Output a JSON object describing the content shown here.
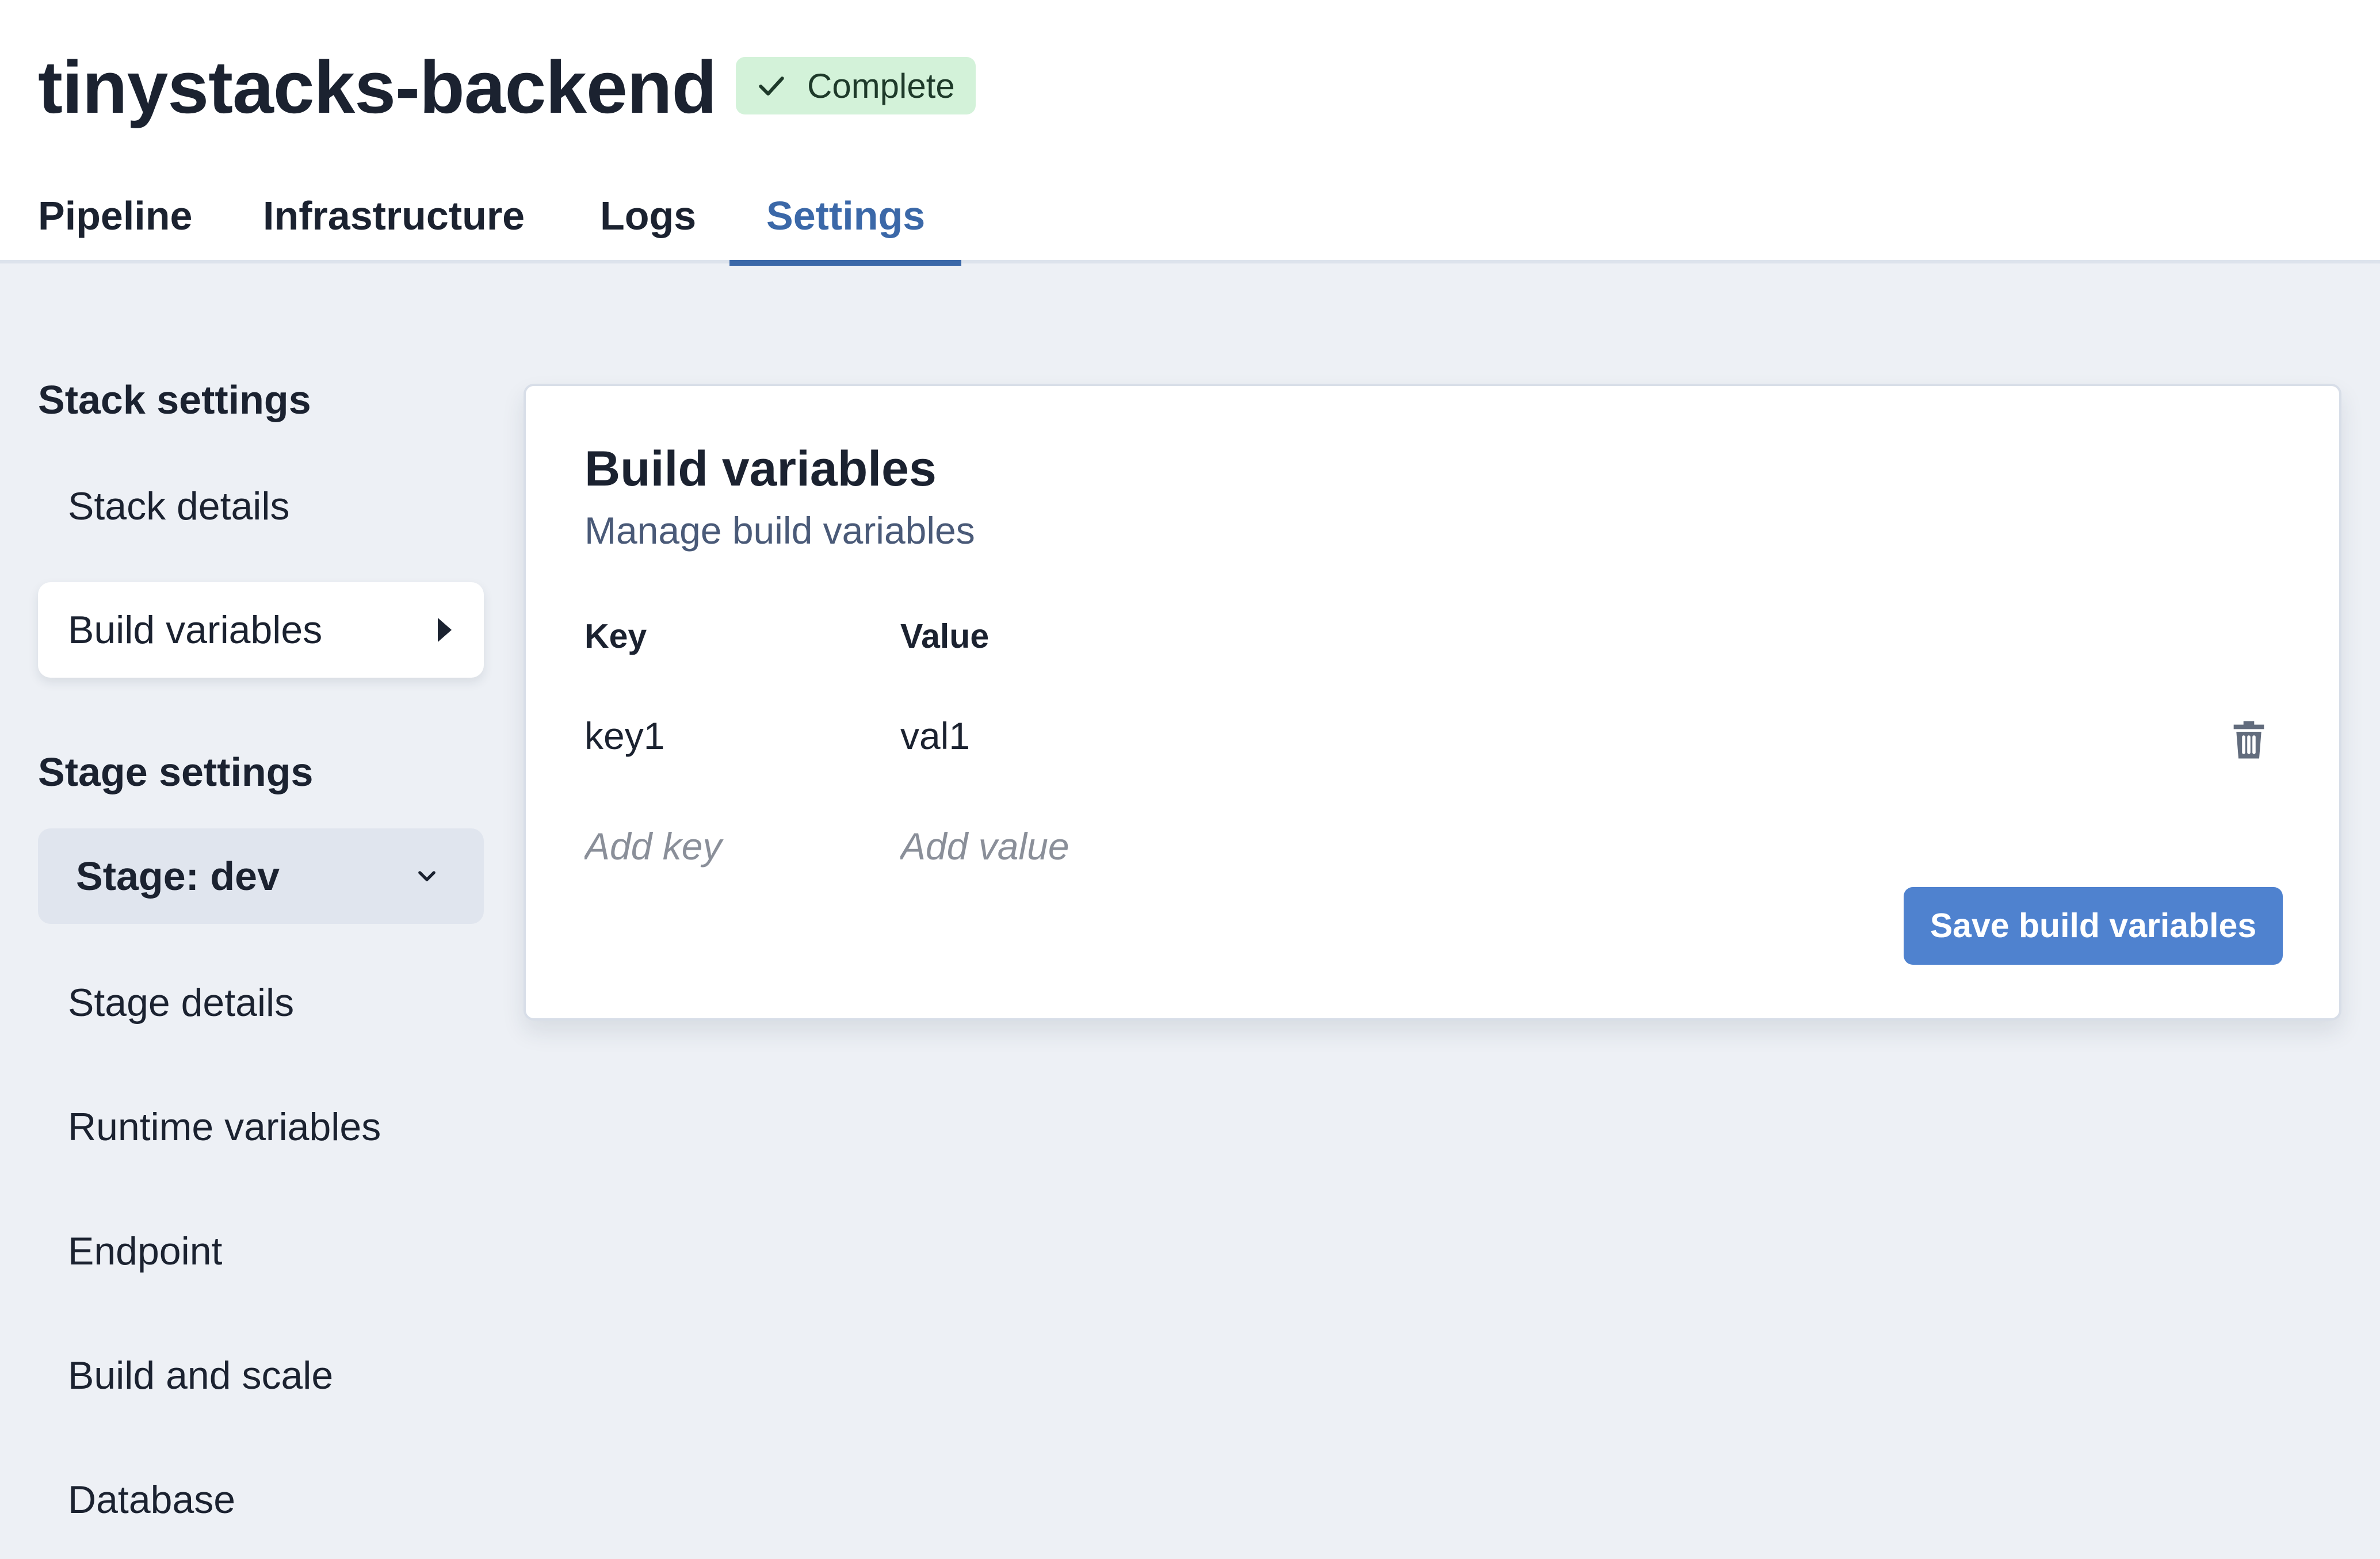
{
  "header": {
    "title": "tinystacks-backend",
    "status": {
      "label": "Complete",
      "icon": "check-icon",
      "color": "#d3f2d9"
    }
  },
  "tabs": [
    {
      "label": "Pipeline",
      "active": false
    },
    {
      "label": "Infrastructure",
      "active": false
    },
    {
      "label": "Logs",
      "active": false
    },
    {
      "label": "Settings",
      "active": true
    }
  ],
  "sidebar": {
    "stack_heading": "Stack settings",
    "stack_items": [
      {
        "label": "Stack details",
        "active": false
      },
      {
        "label": "Build variables",
        "active": true
      }
    ],
    "stage_heading": "Stage settings",
    "stage_select": {
      "label": "Stage: dev"
    },
    "stage_items": [
      {
        "label": "Stage details"
      },
      {
        "label": "Runtime variables"
      },
      {
        "label": "Endpoint"
      },
      {
        "label": "Build and scale"
      },
      {
        "label": "Database"
      }
    ]
  },
  "card": {
    "title": "Build variables",
    "subtitle": "Manage build variables",
    "columns": {
      "key": "Key",
      "value": "Value"
    },
    "rows": [
      {
        "key": "key1",
        "value": "val1"
      }
    ],
    "new_row": {
      "key_placeholder": "Add key",
      "value_placeholder": "Add value"
    },
    "save_label": "Save build variables"
  },
  "colors": {
    "accent": "#3b68a8",
    "button": "#4f82cf",
    "background": "#edf0f5",
    "badge_bg": "#d3f2d9"
  }
}
